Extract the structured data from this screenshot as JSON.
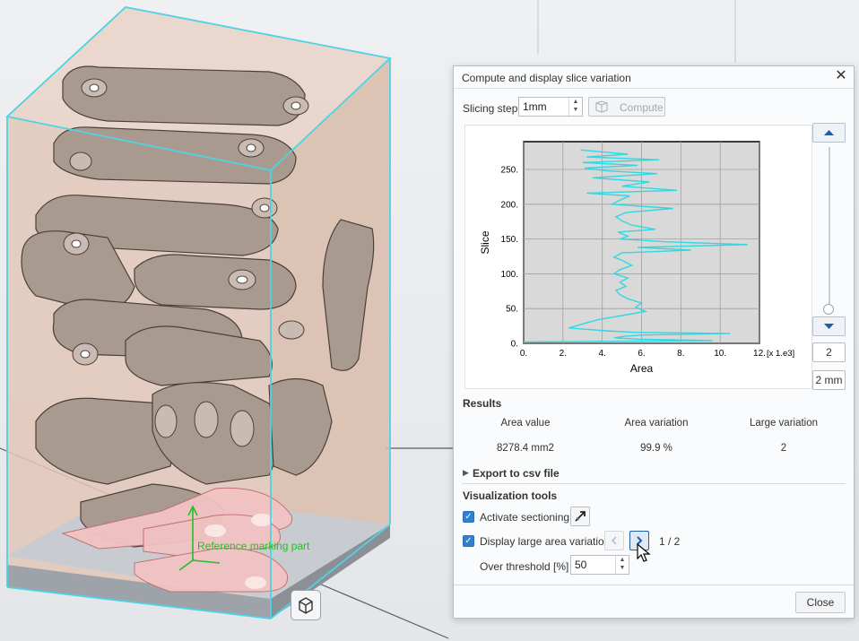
{
  "viewport": {
    "reference_label": "Reference marking part",
    "view_cube_icon": "view-cube-icon"
  },
  "dialog": {
    "title": "Compute and display slice variation",
    "close_icon": "close-icon",
    "slicing_step_label": "Slicing step",
    "slicing_step_value": "1mm",
    "compute_label": "Compute",
    "compute_icon": "compute-icon",
    "slider": {
      "up_icon": "up-arrow-icon",
      "down_icon": "down-arrow-icon",
      "value": "2",
      "unit_value": "2 mm"
    },
    "results": {
      "title": "Results",
      "headers": [
        "Area value",
        "Area variation",
        "Large variation"
      ],
      "values": [
        "8278.4 mm2",
        "99.9 %",
        "2"
      ]
    },
    "export_label": "Export to csv file",
    "visualization": {
      "title": "Visualization tools",
      "activate_sectioning_label": "Activate sectioning",
      "activate_sectioning_checked": true,
      "display_large_label": "Display large area variation",
      "display_large_checked": true,
      "page_indicator": "1 / 2",
      "threshold_label": "Over threshold [%]",
      "threshold_value": "50"
    },
    "close_button_label": "Close"
  },
  "chart_data": {
    "type": "line",
    "xlabel": "Area",
    "ylabel": "Slice",
    "x_unit_label": "[x 1.e3]",
    "xlim": [
      0,
      12
    ],
    "ylim": [
      0,
      290
    ],
    "xticks": [
      "0.",
      "2.",
      "4.",
      "6.",
      "8.",
      "10.",
      "12."
    ],
    "yticks": [
      "0.",
      "50.",
      "100.",
      "150.",
      "200.",
      "250."
    ],
    "grid": true,
    "line_color": "#35d6e0",
    "points": [
      [
        0,
        2
      ],
      [
        9.6,
        4
      ],
      [
        5.9,
        6
      ],
      [
        4.6,
        8
      ],
      [
        5.1,
        10
      ],
      [
        6.1,
        12
      ],
      [
        10.5,
        14
      ],
      [
        5.5,
        16
      ],
      [
        4.2,
        18
      ],
      [
        2.3,
        22
      ],
      [
        3.0,
        28
      ],
      [
        3.8,
        34
      ],
      [
        5.0,
        40
      ],
      [
        6.2,
        46
      ],
      [
        5.7,
        52
      ],
      [
        6.0,
        58
      ],
      [
        5.3,
        64
      ],
      [
        4.9,
        70
      ],
      [
        4.7,
        76
      ],
      [
        5.2,
        82
      ],
      [
        4.9,
        88
      ],
      [
        5.3,
        94
      ],
      [
        4.6,
        100
      ],
      [
        4.9,
        106
      ],
      [
        5.5,
        112
      ],
      [
        5.1,
        118
      ],
      [
        4.6,
        124
      ],
      [
        5.0,
        130
      ],
      [
        8.5,
        134
      ],
      [
        5.8,
        138
      ],
      [
        11.4,
        142
      ],
      [
        7.2,
        146
      ],
      [
        4.9,
        150
      ],
      [
        5.3,
        154
      ],
      [
        4.8,
        160
      ],
      [
        6.7,
        164
      ],
      [
        5.5,
        170
      ],
      [
        5.0,
        176
      ],
      [
        4.7,
        182
      ],
      [
        5.2,
        188
      ],
      [
        7.6,
        194
      ],
      [
        4.5,
        200
      ],
      [
        4.9,
        206
      ],
      [
        5.4,
        212
      ],
      [
        3.2,
        216
      ],
      [
        7.8,
        220
      ],
      [
        5.0,
        226
      ],
      [
        6.4,
        232
      ],
      [
        3.5,
        238
      ],
      [
        6.8,
        244
      ],
      [
        4.2,
        248
      ],
      [
        3.1,
        252
      ],
      [
        5.8,
        256
      ],
      [
        3.0,
        260
      ],
      [
        6.9,
        264
      ],
      [
        3.2,
        268
      ],
      [
        5.3,
        272
      ],
      [
        2.9,
        278
      ]
    ]
  }
}
